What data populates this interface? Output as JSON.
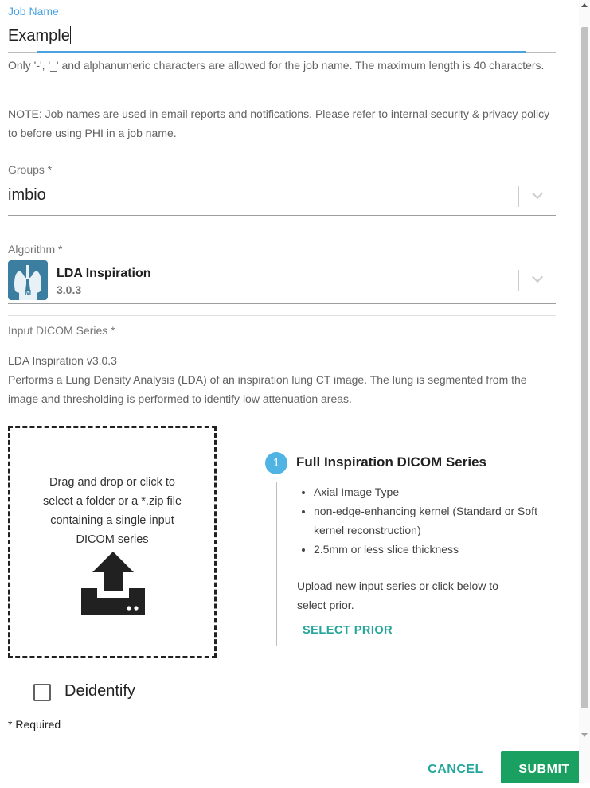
{
  "job_name": {
    "label": "Job Name",
    "value": "Example",
    "help": "Only '-', '_' and alphanumeric characters are allowed for the job name. The maximum length is 40 characters.",
    "note": "NOTE: Job names are used in email reports and notifications. Please refer to internal security & privacy policy to before using PHI in a job name."
  },
  "groups": {
    "label": "Groups *",
    "value": "imbio"
  },
  "algorithm": {
    "label": "Algorithm *",
    "name": "LDA Inspiration",
    "version": "3.0.3",
    "icon_letter": "M"
  },
  "input_series": {
    "label": "Input DICOM Series *",
    "algo_title": "LDA Inspiration v3.0.3",
    "description": "Performs a Lung Density Analysis (LDA) of an inspiration lung CT image. The lung is segmented from the image and thresholding is performed to identify low attenuation areas."
  },
  "dropzone": {
    "text": "Drag and drop or click to select a folder or a *.zip file containing a single input DICOM series",
    "icon": "upload-icon"
  },
  "step": {
    "number": "1",
    "title": "Full Inspiration DICOM Series",
    "requirements": [
      "Axial Image Type",
      "non-edge-enhancing kernel (Standard or Soft kernel reconstruction)",
      "2.5mm or less slice thickness"
    ],
    "upload_hint": "Upload new input series or click below to select prior.",
    "select_prior": "SELECT PRIOR"
  },
  "deidentify": {
    "label": "Deidentify",
    "checked": false
  },
  "required_note": "* Required",
  "actions": {
    "cancel": "CANCEL",
    "submit": "SUBMIT"
  },
  "colors": {
    "accent": "#26a69a",
    "label_blue": "#4aa3df",
    "step_badge": "#4fb3e3",
    "submit_bg": "#1aa162"
  }
}
